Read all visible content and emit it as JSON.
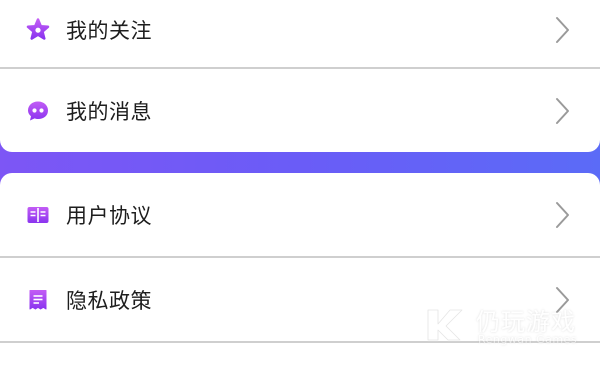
{
  "menu_top": [
    {
      "label": "我的关注",
      "icon": "star-icon"
    },
    {
      "label": "我的消息",
      "icon": "message-icon"
    }
  ],
  "menu_bottom": [
    {
      "label": "用户协议",
      "icon": "book-icon"
    },
    {
      "label": "隐私政策",
      "icon": "document-icon"
    }
  ],
  "watermark": {
    "title": "仍玩游戏",
    "subtitle": "Rengwan Games"
  },
  "colors": {
    "accent_gradient_start": "#7d56f5",
    "accent_gradient_end": "#5b6bf7",
    "icon_purple": "#9b3cf0",
    "divider": "#cfcfcf",
    "chevron": "#9a9a9a"
  }
}
